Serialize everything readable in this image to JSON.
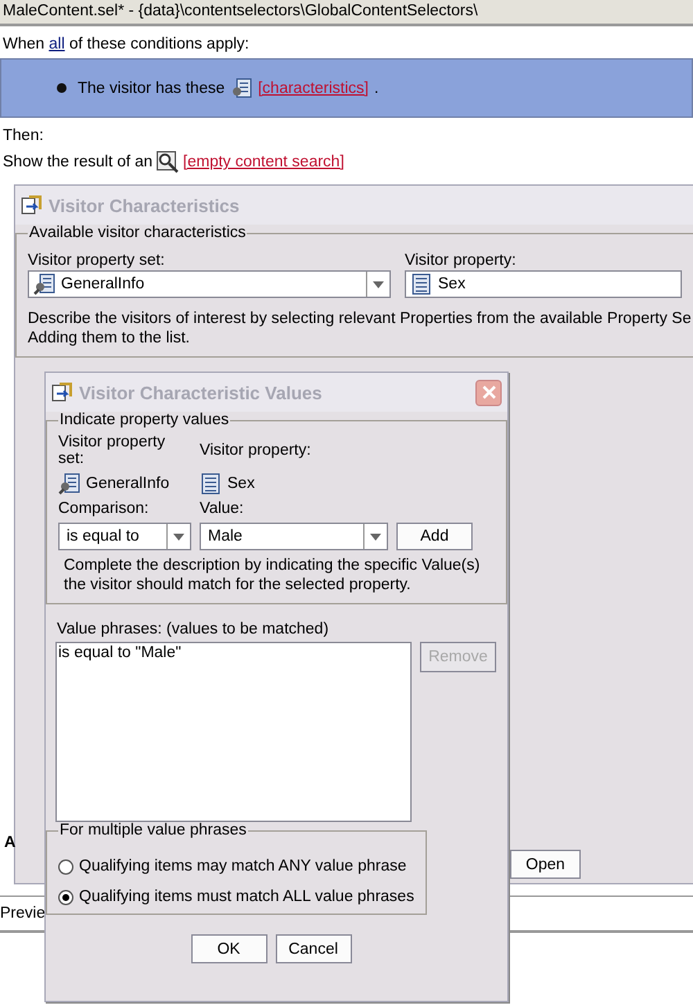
{
  "editor": {
    "title": "MaleContent.sel* - {data}\\contentselectors\\GlobalContentSelectors\\",
    "conditions": {
      "before": "When",
      "link": "all",
      "after": "of these conditions apply:"
    },
    "condition": {
      "text": "The visitor has these",
      "link": "[characteristics]",
      "after": "."
    },
    "then_label": "Then:",
    "result": {
      "text": "Show the result of an",
      "link": "[empty content search]"
    }
  },
  "characteristics_dialog": {
    "title": "Visitor Characteristics",
    "group_title": "Available visitor characteristics",
    "property_set_label": "Visitor property set:",
    "property_set_value": "GeneralInfo",
    "property_label": "Visitor property:",
    "property_value": "Sex",
    "description": "Describe the visitors of interest by selecting relevant Properties from the available Property Se\nAdding them to the list.",
    "side_label": "A",
    "open_button": "Open",
    "preview_label": "Previe"
  },
  "values_dialog": {
    "title": "Visitor Characteristic Values",
    "group_title": "Indicate property values",
    "property_set_label": "Visitor property set:",
    "property_label": "Visitor property:",
    "property_set_value": "GeneralInfo",
    "property_value": "Sex",
    "comparison_label": "Comparison:",
    "value_label": "Value:",
    "comparison_value": "is equal to",
    "value_value": "Male",
    "add_button": "Add",
    "description": "Complete the description by indicating the specific Value(s)\nthe visitor should match for the selected property.",
    "phrases_label": "Value phrases:  (values to be matched)",
    "phrases": [
      "is equal to \"Male\""
    ],
    "remove_button": {
      "label": "Remove",
      "disabled": true
    },
    "multiple_group_title": "For multiple value phrases",
    "options": [
      {
        "label": "Qualifying items may match ANY value phrase",
        "selected": false
      },
      {
        "label": "Qualifying items must match ALL value phrases",
        "selected": true
      }
    ],
    "buttons": [
      "OK",
      "Cancel"
    ]
  }
}
